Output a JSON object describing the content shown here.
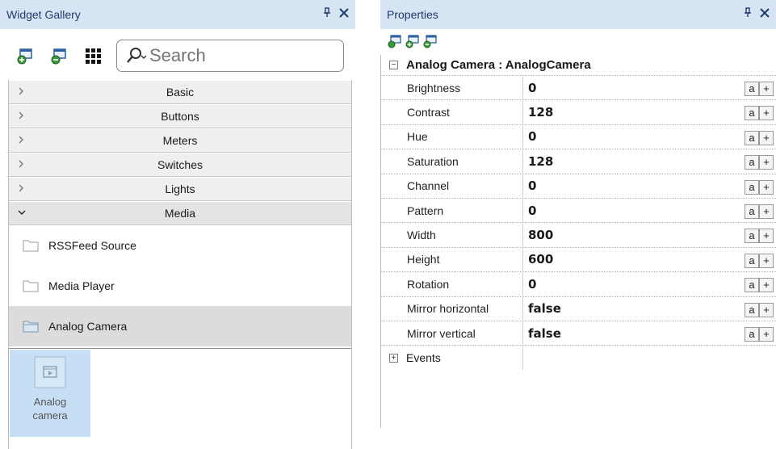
{
  "widget_gallery": {
    "title": "Widget Gallery",
    "pin_glyph": "′",
    "close_glyph": "✕",
    "search": {
      "placeholder": "Search"
    },
    "toolbar_icons": [
      "add-widget-icon",
      "remove-widget-icon",
      "grid-view-icon"
    ],
    "categories": [
      {
        "label": "Basic",
        "expanded": false
      },
      {
        "label": "Buttons",
        "expanded": false
      },
      {
        "label": "Meters",
        "expanded": false
      },
      {
        "label": "Switches",
        "expanded": false
      },
      {
        "label": "Lights",
        "expanded": false
      },
      {
        "label": "Media",
        "expanded": true
      }
    ],
    "media_items": [
      {
        "label": "RSSFeed Source",
        "selected": false
      },
      {
        "label": "Media Player",
        "selected": false
      },
      {
        "label": "Analog Camera",
        "selected": true
      }
    ],
    "tiles": [
      {
        "label_line1": "Analog",
        "label_line2": "camera"
      }
    ]
  },
  "properties": {
    "title": "Properties",
    "pin_glyph": "′",
    "close_glyph": "✕",
    "group_title": "Analog Camera : AnalogCamera",
    "rows": [
      {
        "name": "Brightness",
        "value": "0"
      },
      {
        "name": "Contrast",
        "value": "128"
      },
      {
        "name": "Hue",
        "value": "0"
      },
      {
        "name": "Saturation",
        "value": "128"
      },
      {
        "name": "Channel",
        "value": "0"
      },
      {
        "name": "Pattern",
        "value": "0"
      },
      {
        "name": "Width",
        "value": "800"
      },
      {
        "name": "Height",
        "value": "600"
      },
      {
        "name": "Rotation",
        "value": "0"
      },
      {
        "name": "Mirror horizontal",
        "value": "false"
      },
      {
        "name": "Mirror vertical",
        "value": "false"
      }
    ],
    "row_button_a": "a",
    "row_button_plus": "+",
    "events_label": "Events",
    "expander_minus": "−",
    "expander_plus": "+"
  },
  "colors": {
    "title_bar": "#d7e4f3",
    "selected_tile": "#c7dff4",
    "category_bg": "#efefef"
  }
}
